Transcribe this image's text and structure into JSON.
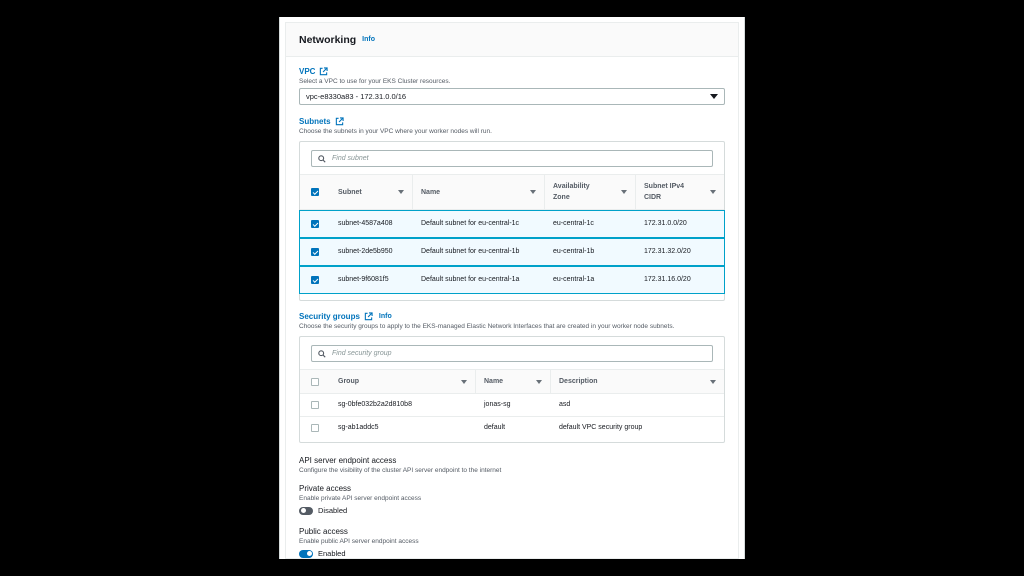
{
  "networking": {
    "title": "Networking",
    "info": "Info"
  },
  "vpc": {
    "label": "VPC",
    "description": "Select a VPC to use for your EKS Cluster resources.",
    "selected": "vpc-e8330a83 - 172.31.0.0/16"
  },
  "subnets": {
    "label": "Subnets",
    "description": "Choose the subnets in your VPC where your worker nodes will run.",
    "search_placeholder": "Find subnet",
    "columns": [
      "Subnet",
      "Name",
      "Availability Zone",
      "Subnet IPv4 CIDR"
    ],
    "rows": [
      {
        "subnet": "subnet-4587a408",
        "name": "Default subnet for eu-central-1c",
        "az": "eu-central-1c",
        "cidr": "172.31.0.0/20",
        "checked": true
      },
      {
        "subnet": "subnet-2de5b950",
        "name": "Default subnet for eu-central-1b",
        "az": "eu-central-1b",
        "cidr": "172.31.32.0/20",
        "checked": true
      },
      {
        "subnet": "subnet-9f6081f5",
        "name": "Default subnet for eu-central-1a",
        "az": "eu-central-1a",
        "cidr": "172.31.16.0/20",
        "checked": true
      }
    ]
  },
  "security_groups": {
    "label": "Security groups",
    "info": "Info",
    "description": "Choose the security groups to apply to the EKS-managed Elastic Network Interfaces that are created in your worker node subnets.",
    "search_placeholder": "Find security group",
    "columns": [
      "Group",
      "Name",
      "Description"
    ],
    "rows": [
      {
        "group": "sg-0bfe032b2a2d810b8",
        "name": "jonas-sg",
        "description": "asd",
        "checked": false
      },
      {
        "group": "sg-ab1addc5",
        "name": "default",
        "description": "default VPC security group",
        "checked": false
      }
    ]
  },
  "endpoint": {
    "title": "API server endpoint access",
    "description": "Configure the visibility of the cluster API server endpoint to the internet",
    "private": {
      "label": "Private access",
      "description": "Enable private API server endpoint access",
      "state": "Disabled"
    },
    "public": {
      "label": "Public access",
      "description": "Enable public API server endpoint access",
      "state": "Enabled"
    }
  },
  "colors": {
    "link": "#0073bb",
    "selected_row_bg": "#f1faff",
    "selected_border": "#00a1c9"
  }
}
